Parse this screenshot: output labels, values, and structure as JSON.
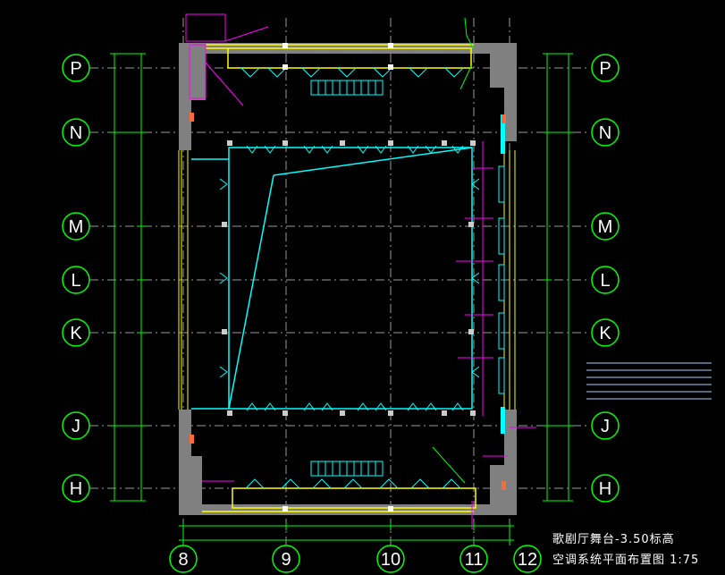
{
  "drawing": {
    "title_line1": "歌剧厅舞台-3.50标高",
    "title_line2": "空调系统平面布置图 1:75",
    "grid_rows_left": [
      "P",
      "N",
      "M",
      "L",
      "K",
      "J",
      "H"
    ],
    "grid_rows_right": [
      "P",
      "N",
      "M",
      "L",
      "K",
      "J",
      "H"
    ],
    "grid_cols_bottom": [
      "8",
      "9",
      "10",
      "11",
      "12"
    ]
  },
  "colors": {
    "background": "#000000",
    "bubble": "#00ff00",
    "wall": "#808080",
    "duct": "#ffff00",
    "stage": "#00ffff",
    "annotation": "#ff00ff",
    "grid_line": "#9a9a9a",
    "text": "#ffffff"
  }
}
